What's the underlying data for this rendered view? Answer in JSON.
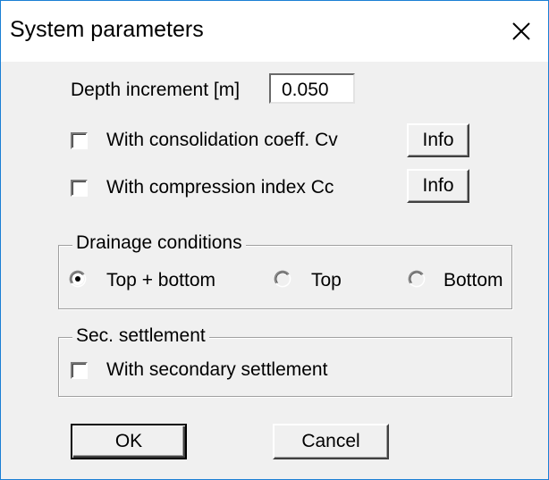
{
  "window": {
    "title": "System parameters"
  },
  "depth": {
    "label": "Depth increment [m]",
    "value": "0.050"
  },
  "options": [
    {
      "label": "With consolidation coeff. Cv",
      "checked": false,
      "info_label": "Info"
    },
    {
      "label": "With compression index Cc",
      "checked": false,
      "info_label": "Info"
    }
  ],
  "drainage": {
    "title": "Drainage conditions",
    "choices": [
      {
        "label": "Top + bottom",
        "selected": true
      },
      {
        "label": "Top",
        "selected": false
      },
      {
        "label": "Bottom",
        "selected": false
      }
    ]
  },
  "secondary": {
    "title": "Sec. settlement",
    "checkbox_label": "With secondary settlement",
    "checked": false
  },
  "buttons": {
    "ok": "OK",
    "cancel": "Cancel"
  },
  "colors": {
    "border": "#1a7fd4",
    "dialog_bg": "#f0f0f0"
  },
  "icons": {
    "close": "close-icon"
  }
}
